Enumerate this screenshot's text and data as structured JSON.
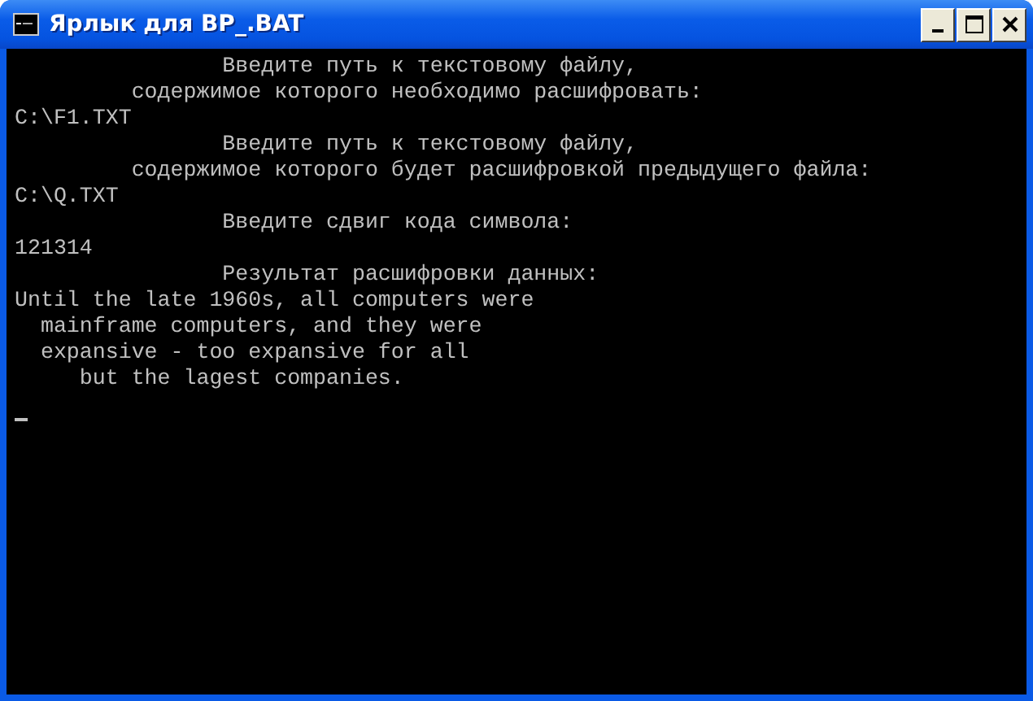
{
  "window": {
    "title": "Ярлык для BP_.BAT"
  },
  "console": {
    "lines": [
      "                Введите путь к текстовому файлу,",
      "         содержимое которого необходимо расшифровать:",
      "C:\\F1.TXT",
      "                Введите путь к текстовому файлу,",
      "         содержимое которого будет расшифровкой предыдущего файла:",
      "C:\\Q.TXT",
      "                Введите сдвиг кода символа:",
      "121314",
      "                Результат расшифровки данных:",
      "Until the late 1960s, all computers were",
      "  mainframe computers, and they were",
      "  expansive - too expansive for all",
      "     but the lagest companies."
    ]
  }
}
